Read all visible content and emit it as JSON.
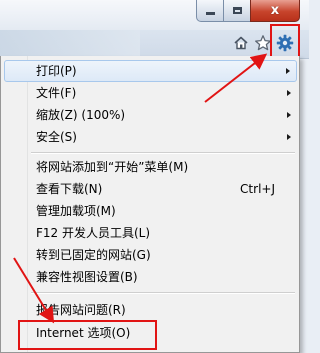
{
  "window": {
    "close_glyph": "x"
  },
  "toolbar": {
    "icons": [
      "home-icon",
      "favorites-star-icon",
      "gear-icon"
    ]
  },
  "menu": {
    "items": [
      {
        "label": "打印(P)",
        "has_submenu": true
      },
      {
        "label": "文件(F)",
        "has_submenu": true
      },
      {
        "label": "缩放(Z) (100%)",
        "has_submenu": true
      },
      {
        "label": "安全(S)",
        "has_submenu": true
      },
      {
        "label": "将网站添加到“开始”菜单(M)"
      },
      {
        "label": "查看下载(N)",
        "shortcut": "Ctrl+J"
      },
      {
        "label": "管理加载项(M)"
      },
      {
        "label": "F12 开发人员工具(L)"
      },
      {
        "label": "转到已固定的网站(G)"
      },
      {
        "label": "兼容性视图设置(B)"
      },
      {
        "label": "报告网站问题(R)"
      },
      {
        "label": "Internet 选项(O)"
      }
    ]
  },
  "colors": {
    "highlight_red": "#e11414",
    "menu_background": "#f1f1f1",
    "hover_border": "#a8c8ec",
    "gear_blue": "#2f6fb3"
  }
}
